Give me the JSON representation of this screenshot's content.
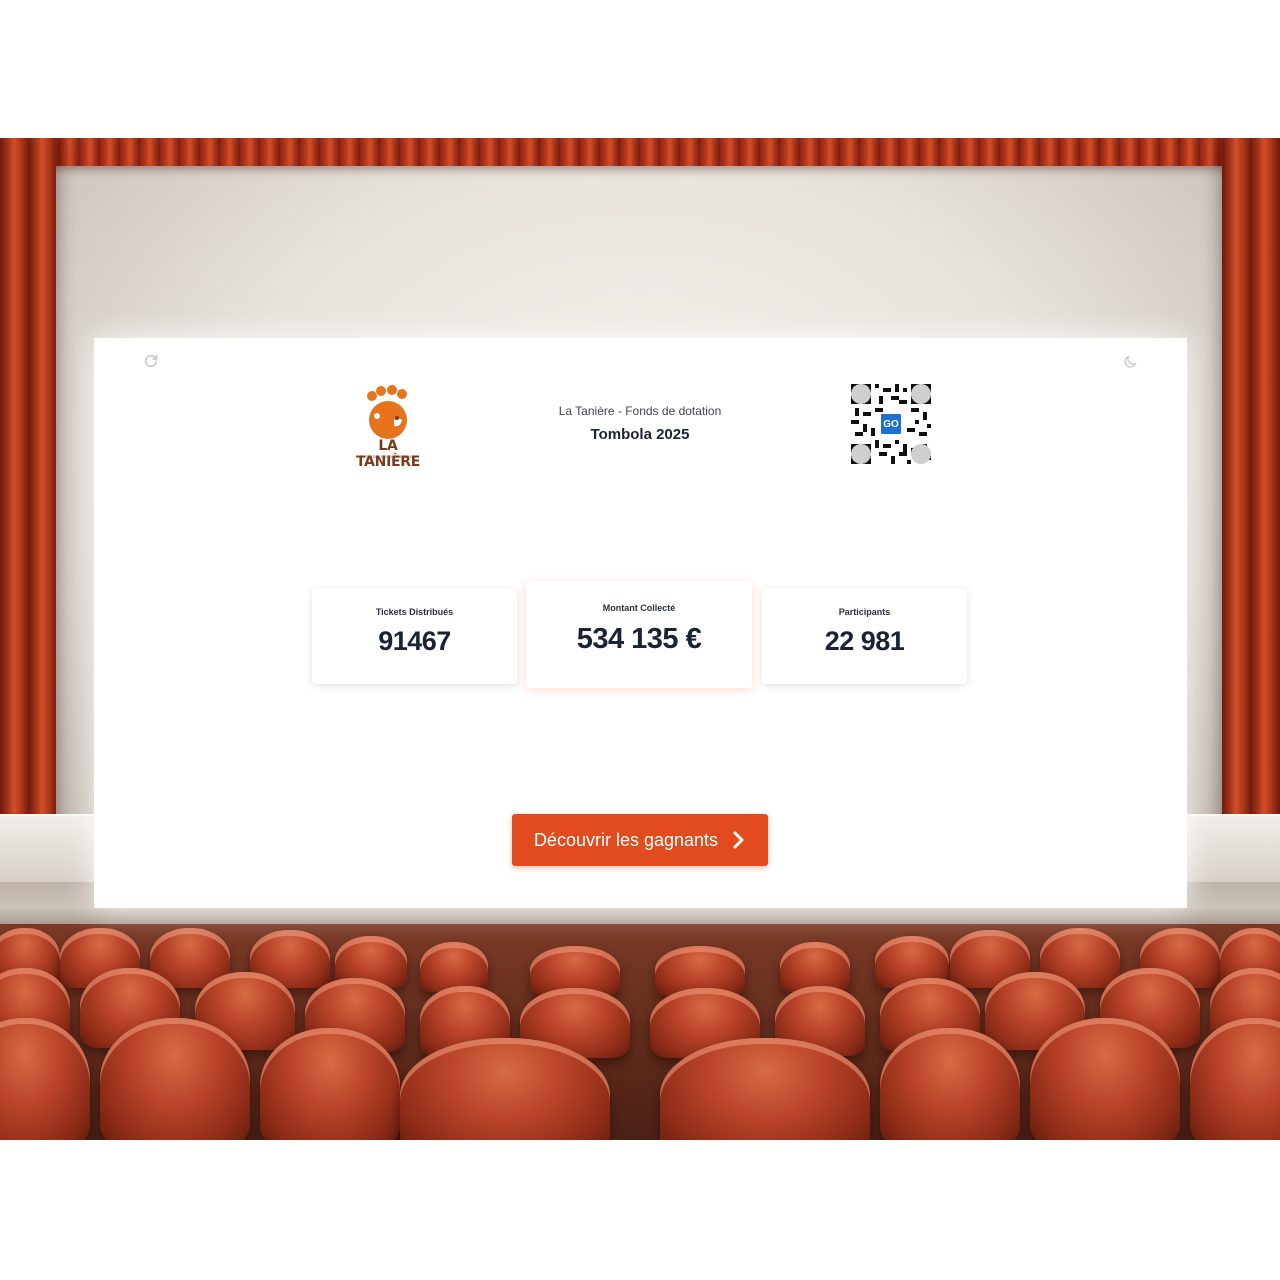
{
  "app": {
    "refresh_icon": "refresh-icon",
    "theme_icon": "moon-icon"
  },
  "header": {
    "logo_text": "LA TANIÈRE",
    "logo_subtext": "FONDS DE DOTATION",
    "organization": "La Tanière - Fonds de dotation",
    "event": "Tombola 2025",
    "qr_label": "GO"
  },
  "stats": [
    {
      "label": "Tickets Distribués",
      "value": "91467"
    },
    {
      "label": "Montant Collecté",
      "value": "534 135 €"
    },
    {
      "label": "Participants",
      "value": "22 981"
    }
  ],
  "cta": {
    "label": "Découvrir les gagnants",
    "icon": "chevron-right-icon"
  },
  "colors": {
    "accent": "#e14b1e",
    "logo_orange": "#e8731e",
    "logo_brown": "#7a3b1c",
    "text_dark": "#1a2236"
  }
}
